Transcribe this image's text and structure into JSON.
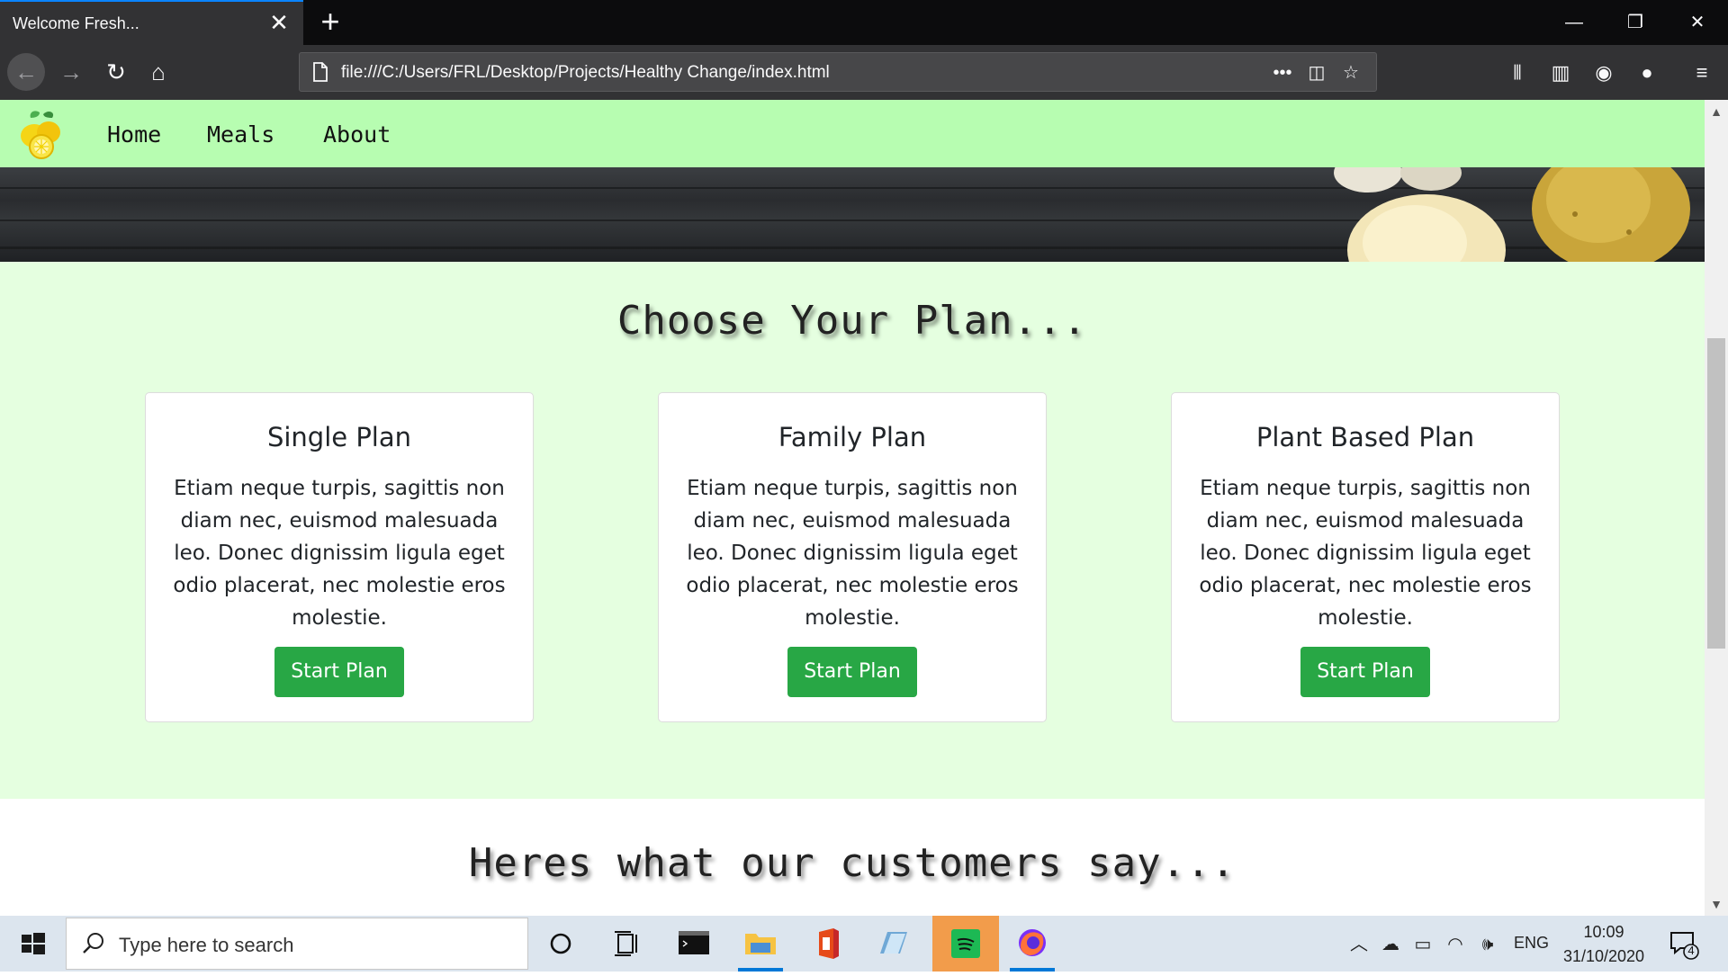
{
  "browser": {
    "tab_title": "Welcome Fresh...",
    "url": "file:///C:/Users/FRL/Desktop/Projects/Healthy Change/index.html"
  },
  "site": {
    "nav": [
      "Home",
      "Meals",
      "About"
    ],
    "plans_heading": "Choose Your Plan...",
    "plans": [
      {
        "title": "Single Plan",
        "text": "Etiam neque turpis, sagittis non diam nec, euismod malesuada leo. Donec dignissim ligula eget odio placerat, nec molestie eros molestie.",
        "button": "Start Plan"
      },
      {
        "title": "Family Plan",
        "text": "Etiam neque turpis, sagittis non diam nec, euismod malesuada leo. Donec dignissim ligula eget odio placerat, nec molestie eros molestie.",
        "button": "Start Plan"
      },
      {
        "title": "Plant Based Plan",
        "text": "Etiam neque turpis, sagittis non diam nec, euismod malesuada leo. Donec dignissim ligula eget odio placerat, nec molestie eros molestie.",
        "button": "Start Plan"
      }
    ],
    "testimonials_heading": "Heres what our customers say..."
  },
  "taskbar": {
    "search_placeholder": "Type here to search",
    "language": "ENG",
    "time": "10:09",
    "date": "31/10/2020",
    "notification_count": "4"
  },
  "colors": {
    "site_nav_bg": "#b7fdb1",
    "plans_bg": "#e5ffe0",
    "button_green": "#28a745",
    "tab_accent": "#0a84ff"
  }
}
